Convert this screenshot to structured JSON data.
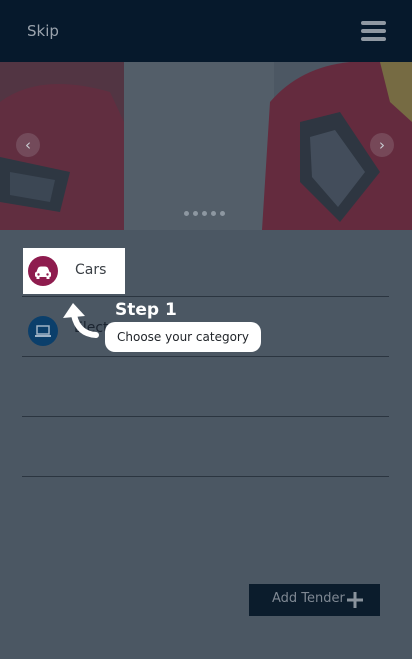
{
  "header": {
    "skip_label": "Skip",
    "menu_icon": "hamburger-menu-icon"
  },
  "banner": {
    "slide_count": 5,
    "active_slide": 1,
    "prev_icon": "chevron-left-icon",
    "next_icon": "chevron-right-icon"
  },
  "categories": [
    {
      "label": "Cars",
      "icon": "car-icon",
      "color": "#8e1c4e"
    },
    {
      "label": "Electronics",
      "icon": "laptop-icon",
      "color": "#0b3f6b"
    }
  ],
  "onboarding": {
    "step_title": "Step 1",
    "step_text": "Choose your category"
  },
  "footer": {
    "add_tender_label": "Add Tender",
    "add_icon": "plus-icon"
  }
}
